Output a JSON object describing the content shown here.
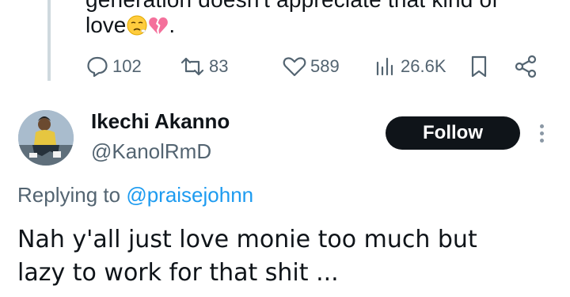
{
  "previous_tweet": {
    "text_fragment": "love",
    "emoji_after": [
      "sad-face-emoji",
      "broken-heart-emoji"
    ],
    "trailing": ".",
    "actions": {
      "replies": "102",
      "reposts": "83",
      "likes": "589",
      "views": "26.6K"
    }
  },
  "reply_tweet": {
    "author_name": "Ikechi Akanno",
    "handle": "@KanolRmD",
    "follow_label": "Follow",
    "replying_prefix": "Replying to",
    "replying_to": "@praisejohnn",
    "body_lines": [
      "Nah y'all just love monie too much but",
      "lazy to work for that shit ..."
    ]
  },
  "colors": {
    "text": "#0f1419",
    "secondary": "#536471",
    "link": "#1d9bf0",
    "follow_bg": "#0f1419",
    "heart_pink": "#f4709b"
  }
}
